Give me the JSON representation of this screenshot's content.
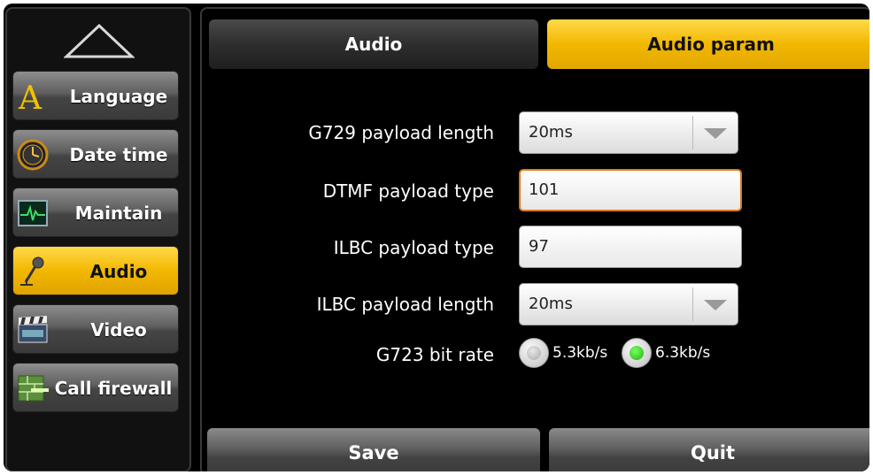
{
  "sidebar": {
    "items": [
      {
        "label": "Language",
        "icon": "letter-a-icon",
        "active": false
      },
      {
        "label": "Date time",
        "icon": "clock-icon",
        "active": false
      },
      {
        "label": "Maintain",
        "icon": "monitor-icon",
        "active": false
      },
      {
        "label": "Audio",
        "icon": "microphone-icon",
        "active": true
      },
      {
        "label": "Video",
        "icon": "clapperboard-icon",
        "active": false
      },
      {
        "label": "Call firewall",
        "icon": "firewall-icon",
        "active": false
      }
    ]
  },
  "tabs": {
    "audio": "Audio",
    "audio_param": "Audio param",
    "active": "audio_param"
  },
  "form": {
    "g729_label": "G729 payload length",
    "g729_value": "20ms",
    "dtmf_label": "DTMF payload type",
    "dtmf_value": "101",
    "ilbc_type_label": "ILBC payload type",
    "ilbc_type_value": "97",
    "ilbc_length_label": "ILBC payload length",
    "ilbc_length_value": "20ms",
    "g723_label": "G723 bit rate",
    "g723_option_1": "5.3kb/s",
    "g723_option_2": "6.3kb/s",
    "g723_selected": "6.3kb/s"
  },
  "actions": {
    "save": "Save",
    "quit": "Quit"
  },
  "colors": {
    "accent": "#f2b800",
    "focus": "#e07b1a",
    "radio_checked": "#18b400"
  }
}
